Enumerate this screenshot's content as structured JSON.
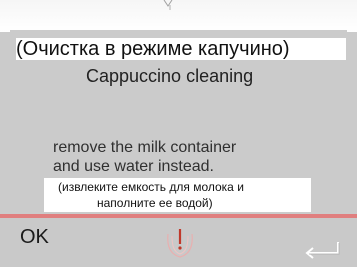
{
  "dialog": {
    "title_ru": "(Очистка в режиме капучино)",
    "title_en": "Cappuccino cleaning",
    "message_en_line1": "remove the milk container",
    "message_en_line2": "and use water instead.",
    "message_ru_line1": "(извлеките емкость для молока и",
    "message_ru_line2": "наполните ее водой)"
  },
  "footer": {
    "ok_label": "OK",
    "center_icon": "warning-drop-icon",
    "right_icon": "enter-return-icon"
  },
  "colors": {
    "background": "#cbcbcb",
    "accent_line": "#e07a7a"
  }
}
